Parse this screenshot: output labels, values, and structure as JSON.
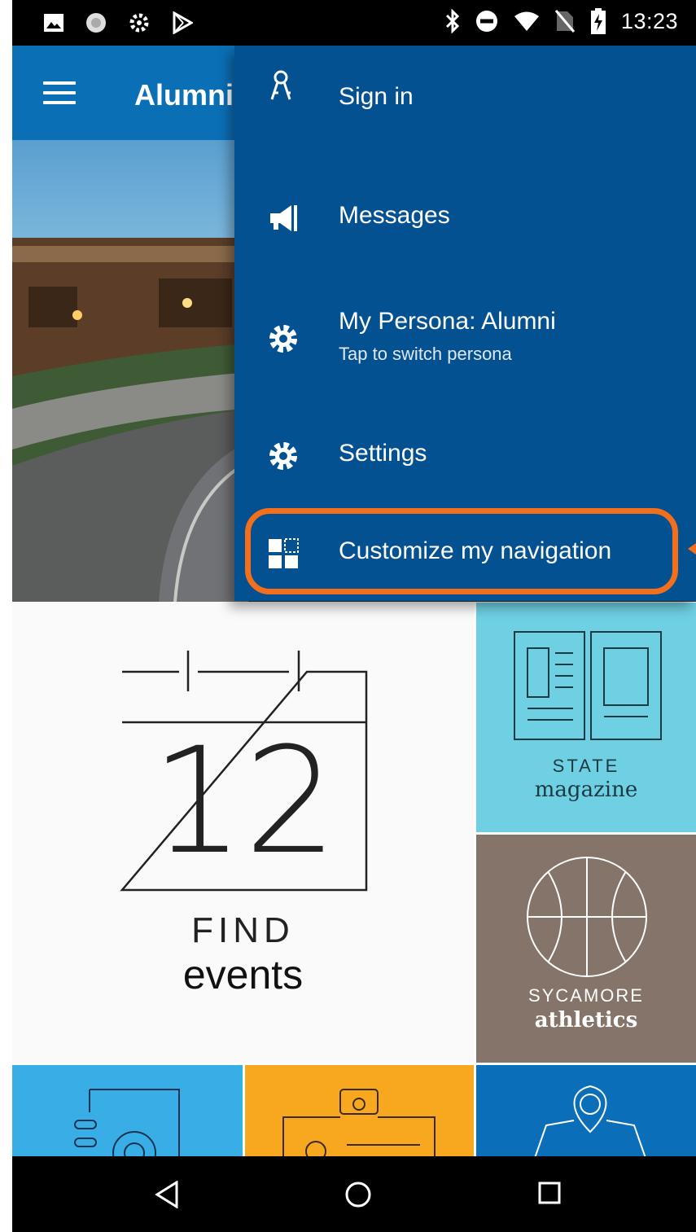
{
  "status_bar": {
    "time": "13:23",
    "icons_left": [
      "image-icon",
      "circle-notification-icon",
      "settings-cog-icon",
      "play-store-icon"
    ],
    "icons_right": [
      "bluetooth-icon",
      "do-not-disturb-icon",
      "wifi-icon",
      "no-sim-icon",
      "battery-charging-icon"
    ]
  },
  "app_bar": {
    "title": "Alumni",
    "background_color": "#0b6fb6"
  },
  "menu": {
    "background_color": "#045192",
    "items": [
      {
        "label": "Sign in",
        "icon": "keys-icon"
      },
      {
        "label": "Messages",
        "icon": "megaphone-icon"
      },
      {
        "label": "My Persona: Alumni",
        "sublabel": "Tap to switch persona",
        "icon": "gear-icon"
      },
      {
        "label": "Settings",
        "icon": "gear-icon"
      },
      {
        "label": "Customize my navigation",
        "icon": "grid-customize-icon",
        "highlighted": true
      }
    ],
    "highlight_color": "#f36f1c"
  },
  "tiles": {
    "events": {
      "day": "12",
      "line1": "FIND",
      "line2": "events"
    },
    "magazine": {
      "line1": "STATE",
      "line2": "magazine",
      "color": "#6fd0e3"
    },
    "athletics": {
      "line1": "SYCAMORE",
      "line2": "athletics",
      "color": "#857469"
    },
    "bottom_colors": [
      "#39aee6",
      "#f8a81f",
      "#0a6fb8"
    ]
  },
  "nav_bar": {
    "buttons": [
      "back-icon",
      "home-icon",
      "recents-icon"
    ]
  }
}
